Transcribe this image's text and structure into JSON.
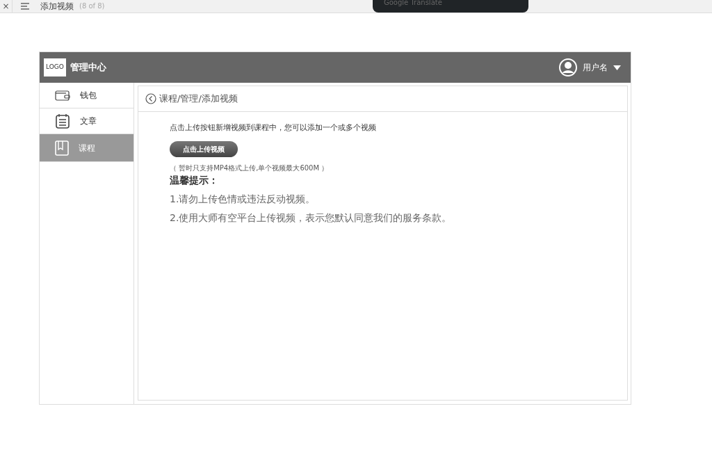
{
  "viewer_bar": {
    "close": "×",
    "title": "添加视频",
    "counter": "(8 of 8)"
  },
  "popup": {
    "text": "Google Translate"
  },
  "header": {
    "logo": "LOGO",
    "title": "管理中心",
    "user": "用户名"
  },
  "sidebar": {
    "items": [
      {
        "label": "钱包",
        "kind": "wallet",
        "selected": false
      },
      {
        "label": "文章",
        "kind": "calendar",
        "selected": false
      },
      {
        "label": "课程",
        "kind": "book",
        "selected": true
      }
    ]
  },
  "breadcrumb": "课程/管理/添加视频",
  "intro": "点击上传按钮新增视频到课程中，您可以添加一个或多个视频",
  "upload_button": "点击上传视频",
  "note": "（ 暂时只支持MP4格式上传,单个视频最大600M ）",
  "tips_title": "温馨提示：",
  "tips": [
    "1.请勿上传色情或违法反动视频。",
    "2.使用大师有空平台上传视频，表示您默认同意我们的服务条款。"
  ]
}
